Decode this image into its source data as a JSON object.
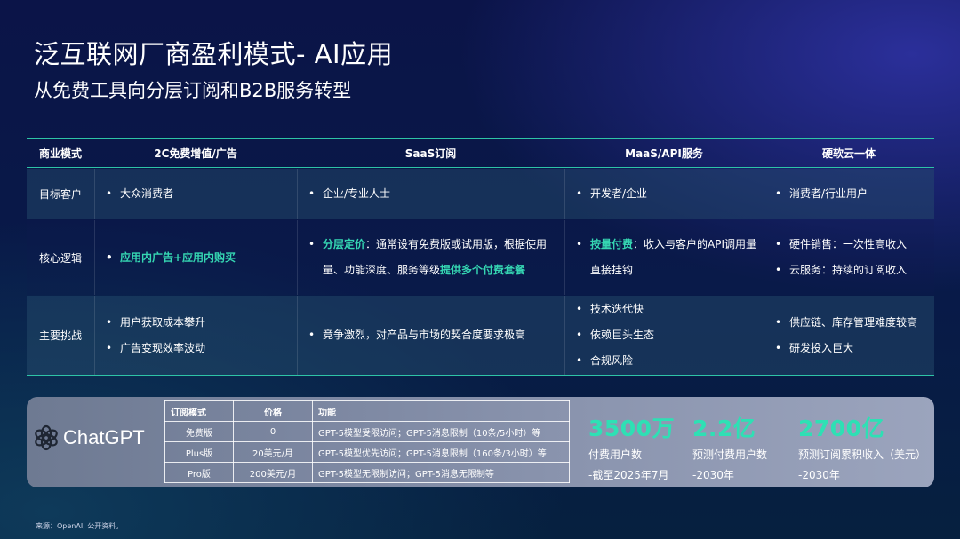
{
  "title": "泛互联网厂商盈利模式- AI应用",
  "subtitle": "从免费工具向分层订阅和B2B服务转型",
  "table": {
    "headers": [
      "商业模式",
      "2C免费增值/广告",
      "SaaS订阅",
      "MaaS/API服务",
      "硬软云一体"
    ],
    "rows": {
      "target": {
        "label": "目标客户",
        "c1": [
          "大众消费者"
        ],
        "c2": [
          "企业/专业人士"
        ],
        "c3": [
          "开发者/企业"
        ],
        "c4": [
          "消费者/行业用户"
        ]
      },
      "logic": {
        "label": "核心逻辑",
        "c1": "应用内广告+应用内购买",
        "c2": {
          "accent": "分层定价",
          "text": "：通常设有免费版或试用版，根据使用量、功能深度、服务等级",
          "accent2": "提供多个付费套餐"
        },
        "c3": {
          "accent": "按量付费",
          "text": "：收入与客户的API调用量直接挂钩"
        },
        "c4": [
          "硬件销售：一次性高收入",
          "云服务：持续的订阅收入"
        ]
      },
      "challenge": {
        "label": "主要挑战",
        "c1": [
          "用户获取成本攀升",
          "广告变现效率波动"
        ],
        "c2": [
          "竞争激烈，对产品与市场的契合度要求极高"
        ],
        "c3": [
          "技术迭代快",
          "依赖巨头生态",
          "合规风险"
        ],
        "c4": [
          "供应链、库存管理难度较高",
          "研发投入巨大"
        ]
      }
    }
  },
  "chatgpt": {
    "logo_text": "ChatGPT",
    "headers": [
      "订阅模式",
      "价格",
      "功能"
    ],
    "rows": [
      {
        "mode": "免费版",
        "price": "0",
        "feature": "GPT-5模型受限访问；GPT-5消息限制（10条/5小时）等"
      },
      {
        "mode": "Plus版",
        "price": "20美元/月",
        "feature": "GPT-5模型优先访问；GPT-5消息限制（160条/3小时）等"
      },
      {
        "mode": "Pro版",
        "price": "200美元/月",
        "feature": "GPT-5模型无限制访问；GPT-5消息无限制等"
      }
    ],
    "stats": [
      {
        "num": "3500万",
        "label1": "付费用户数",
        "label2": "-截至2025年7月"
      },
      {
        "num": "2.2亿",
        "label1": "预测付费用户数",
        "label2": "-2030年"
      },
      {
        "num": "2700亿",
        "label1": "预测订阅累积收入（美元）",
        "label2": "-2030年"
      }
    ]
  },
  "source": "来源：OpenAI, 公开资料。",
  "colors": {
    "accent": "#35d6b2",
    "background": "#0b1448",
    "panel": "#7b86a0"
  }
}
